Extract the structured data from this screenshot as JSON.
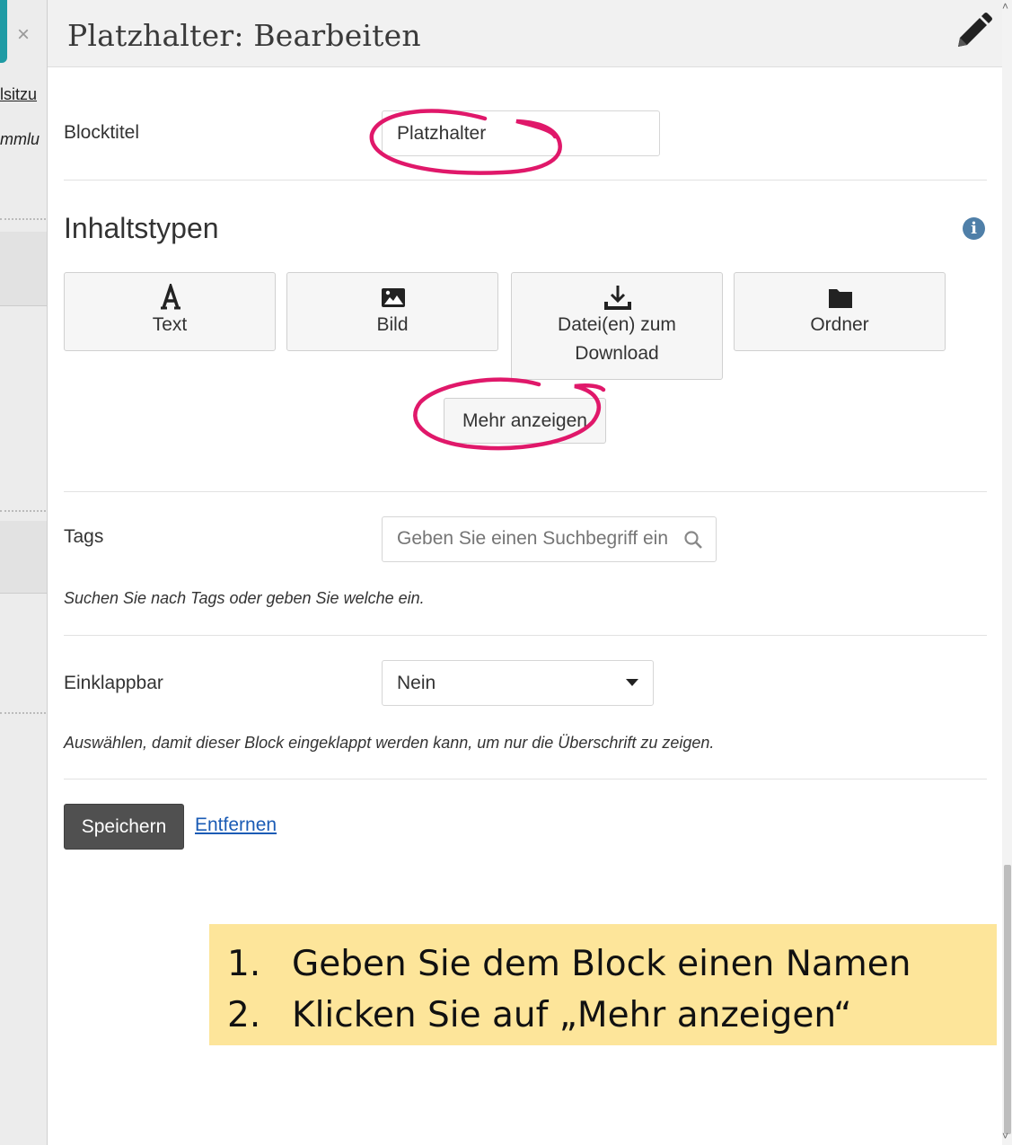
{
  "background": {
    "link_fragment": "lsitzu",
    "italic_fragment": "mmlu"
  },
  "modal": {
    "close_symbol": "×",
    "title": "Platzhalter: Bearbeiten",
    "header_icon": "pencil-icon"
  },
  "form": {
    "block_title": {
      "label": "Blocktitel",
      "value": "Platzhalter"
    },
    "content_types": {
      "heading": "Inhaltstypen",
      "info_icon": "info-icon",
      "types": [
        {
          "label": "Text",
          "icon": "text-icon"
        },
        {
          "label": "Bild",
          "icon": "image-icon"
        },
        {
          "label": "Datei(en) zum Download",
          "icon": "download-icon"
        },
        {
          "label": "Ordner",
          "icon": "folder-icon"
        }
      ],
      "more_label": "Mehr anzeigen"
    },
    "tags": {
      "label": "Tags",
      "placeholder": "Geben Sie einen Suchbegriff ein",
      "help": "Suchen Sie nach Tags oder geben Sie welche ein."
    },
    "collapsible": {
      "label": "Einklappbar",
      "selected": "Nein",
      "help": "Auswählen, damit dieser Block eingeklappt werden kann, um nur die Überschrift zu zeigen."
    },
    "actions": {
      "save_label": "Speichern",
      "remove_label": "Entfernen"
    }
  },
  "instructions": [
    {
      "number": "1.",
      "text": "Geben Sie dem Block einen Namen"
    },
    {
      "number": "2.",
      "text": "Klicken Sie auf „Mehr anzeigen“"
    }
  ],
  "colors": {
    "accent_teal": "#1f9ba4",
    "annotation_pink": "#e0186a",
    "note_yellow": "#fde59a",
    "save_button": "#505050",
    "link_blue": "#1a5bb5"
  }
}
